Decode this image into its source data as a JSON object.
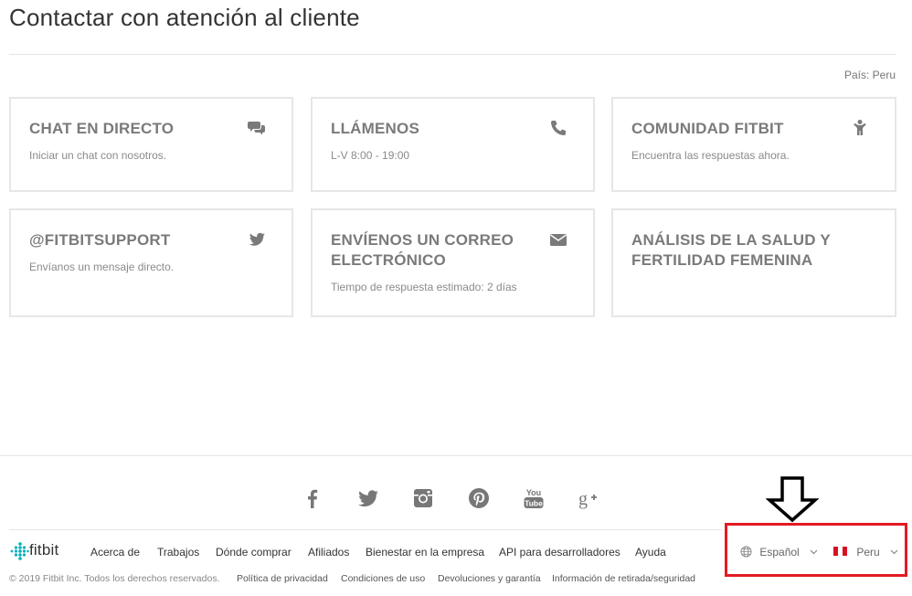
{
  "page": {
    "title": "Contactar con atención al cliente",
    "country_line": "País: Peru"
  },
  "cards": [
    {
      "title": "CHAT EN DIRECTO",
      "subtitle": "Iniciar un chat con nosotros.",
      "icon": "chat-icon"
    },
    {
      "title": "LLÁMENOS",
      "subtitle": "L-V 8:00 - 19:00",
      "icon": "phone-icon"
    },
    {
      "title": "COMUNIDAD FITBIT",
      "subtitle": "Encuentra las respuestas ahora.",
      "icon": "community-icon"
    },
    {
      "title": "@FITBITSUPPORT",
      "subtitle": "Envíanos un mensaje directo.",
      "icon": "twitter-icon"
    },
    {
      "title": "ENVÍENOS UN CORREO ELECTRÓNICO",
      "subtitle": "Tiempo de respuesta estimado: 2 días",
      "icon": "envelope-icon"
    },
    {
      "title": "ANÁLISIS DE LA SALUD Y FERTILIDAD FEMENINA",
      "subtitle": "",
      "icon": ""
    }
  ],
  "social": [
    "facebook-icon",
    "twitter-icon",
    "instagram-icon",
    "pinterest-icon",
    "youtube-icon",
    "google-plus-icon"
  ],
  "footer": {
    "logo": "fitbit",
    "nav": [
      "Acerca de",
      "Trabajos",
      "Dónde comprar",
      "Afiliados",
      "Bienestar en la empresa",
      "API para desarrolladores",
      "Ayuda"
    ],
    "copyright": "© 2019 Fitbit Inc. Todos los derechos reservados.",
    "legal": [
      "Política de privacidad",
      "Condiciones de uso",
      "Devoluciones y garantía",
      "Información de retirada/seguridad"
    ],
    "language": "Español",
    "country": "Peru"
  },
  "colors": {
    "highlight": "#e21b22",
    "brand": "#00b0b9",
    "flag_red": "#d91023"
  }
}
